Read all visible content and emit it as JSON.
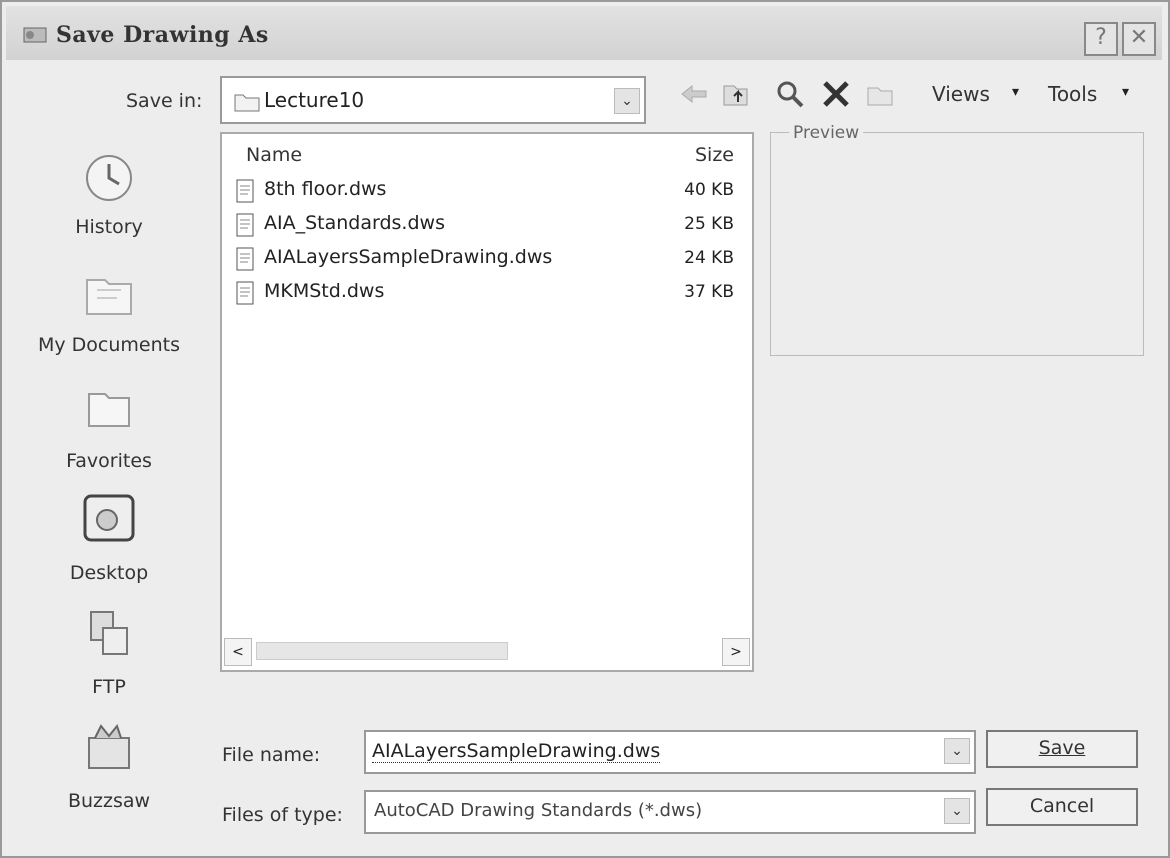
{
  "window": {
    "title": "Save Drawing As",
    "help_label": "?",
    "close_label": "✕"
  },
  "toolbar": {
    "save_in_label": "Save in:",
    "save_in_value": "Lecture10",
    "views_label": "Views",
    "tools_label": "Tools",
    "dropdown_glyph": "▾",
    "combo_glyph": "⌄"
  },
  "places": [
    {
      "label": "History",
      "icon": "history-icon"
    },
    {
      "label": "My Documents",
      "icon": "my-documents-icon"
    },
    {
      "label": "Favorites",
      "icon": "favorites-icon"
    },
    {
      "label": "Desktop",
      "icon": "desktop-icon"
    },
    {
      "label": "FTP",
      "icon": "ftp-icon"
    },
    {
      "label": "Buzzsaw",
      "icon": "buzzsaw-icon"
    }
  ],
  "file_list": {
    "columns": {
      "name": "Name",
      "size": "Size"
    },
    "files": [
      {
        "name": "8th floor.dws",
        "size": "40 KB"
      },
      {
        "name": "AIA_Standards.dws",
        "size": "25 KB"
      },
      {
        "name": "AIALayersSampleDrawing.dws",
        "size": "24 KB"
      },
      {
        "name": "MKMStd.dws",
        "size": "37 KB"
      }
    ],
    "scroll_left": "<",
    "scroll_right": ">"
  },
  "preview": {
    "label": "Preview"
  },
  "form": {
    "file_name_label": "File name:",
    "file_name_value": "AIALayersSampleDrawing.dws",
    "file_type_label": "Files of type:",
    "file_type_value": "AutoCAD Drawing Standards (*.dws)"
  },
  "buttons": {
    "save": "Save",
    "cancel": "Cancel"
  }
}
